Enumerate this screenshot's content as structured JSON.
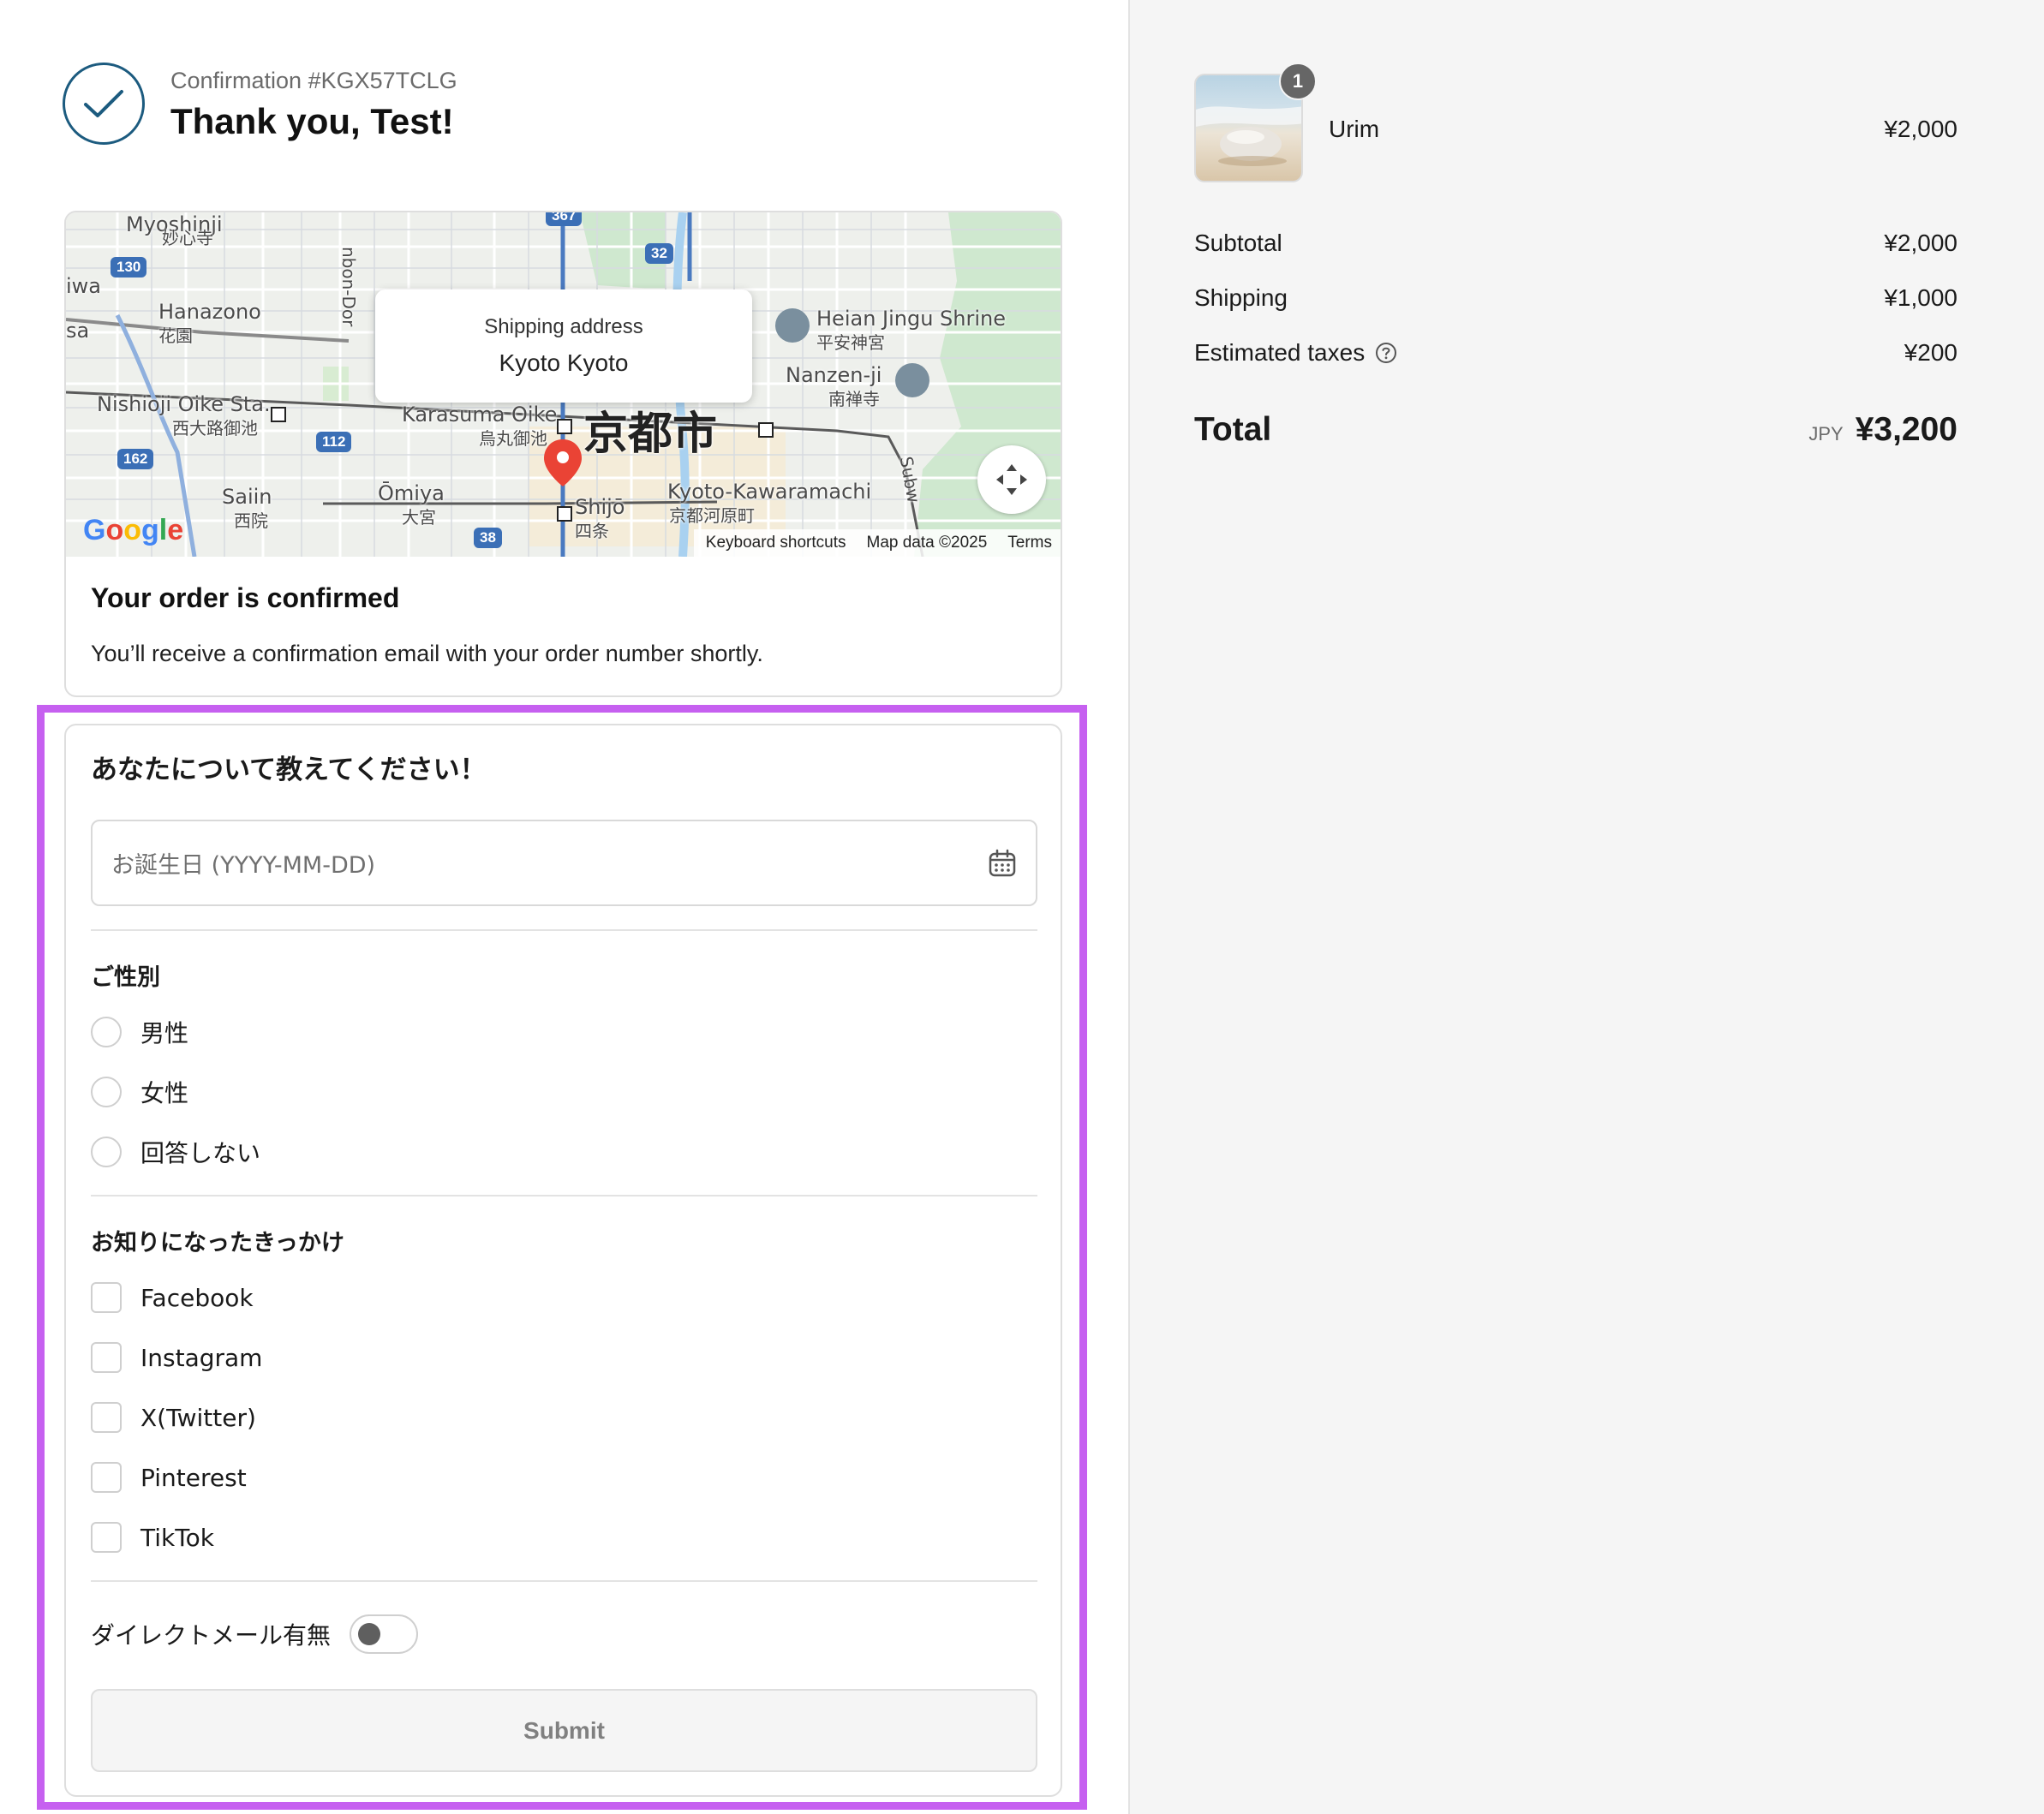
{
  "header": {
    "confirmation": "Confirmation #KGX57TCLG",
    "thanks": "Thank you, Test!"
  },
  "map": {
    "shipping_label": "Shipping address",
    "shipping_value": "Kyoto Kyoto",
    "labels": {
      "myoshinji": "Myoshinji",
      "myoshinji_jp": "妙心寺",
      "hanazono": "Hanazono",
      "hanazono_jp": "花園",
      "nishioji": "Nishioji Oike Sta.",
      "nishioji_jp": "西大路御池",
      "karasuma": "Karasuma Oike",
      "karasuma_jp": "烏丸御池",
      "kyoto_city": "京都市",
      "heian": "Heian Jingu Shrine",
      "heian_jp": "平安神宮",
      "nanzenji": "Nanzen-ji",
      "nanzenji_jp": "南禅寺",
      "saiin": "Saiin",
      "saiin_jp": "西院",
      "omiya": "Ōmiya",
      "omiya_jp": "大宮",
      "shijo": "Shijō",
      "shijo_jp": "四条",
      "kawaramachi": "Kyoto-Kawaramachi",
      "kawaramachi_jp": "京都河原町",
      "iwa": "iwa",
      "sa": "sa",
      "subw": "Subw",
      "road_top": "nbon-Dor"
    },
    "shields": {
      "s130": "130",
      "s32": "32",
      "s367": "367",
      "s112": "112",
      "s162": "162",
      "s38": "38"
    },
    "google": [
      "G",
      "o",
      "o",
      "g",
      "l",
      "e"
    ],
    "footer": {
      "shortcuts": "Keyboard shortcuts",
      "data": "Map data ©2025",
      "terms": "Terms"
    }
  },
  "order": {
    "title": "Your order is confirmed",
    "text": "You’ll receive a confirmation email with your order number shortly."
  },
  "form": {
    "title": "あなたについて教えてください！",
    "birthday_placeholder": "お誕生日 (YYYY-MM-DD)",
    "gender_title": "ご性別",
    "gender_options": [
      "男性",
      "女性",
      "回答しない"
    ],
    "source_title": "お知りになったきっかけ",
    "source_options": [
      "Facebook",
      "Instagram",
      "X(Twitter)",
      "Pinterest",
      "TikTok"
    ],
    "dm_label": "ダイレクトメール有無",
    "submit": "Submit"
  },
  "summary": {
    "item": {
      "name": "Urim",
      "qty": "1",
      "price": "¥2,000"
    },
    "subtotal_label": "Subtotal",
    "subtotal": "¥2,000",
    "shipping_label": "Shipping",
    "shipping": "¥1,000",
    "taxes_label": "Estimated taxes",
    "taxes": "¥200",
    "total_label": "Total",
    "currency": "JPY",
    "total": "¥3,200"
  },
  "colors": {
    "accent": "#1c5b7f",
    "highlight": "#c660f0",
    "pin": "#ea4335"
  }
}
